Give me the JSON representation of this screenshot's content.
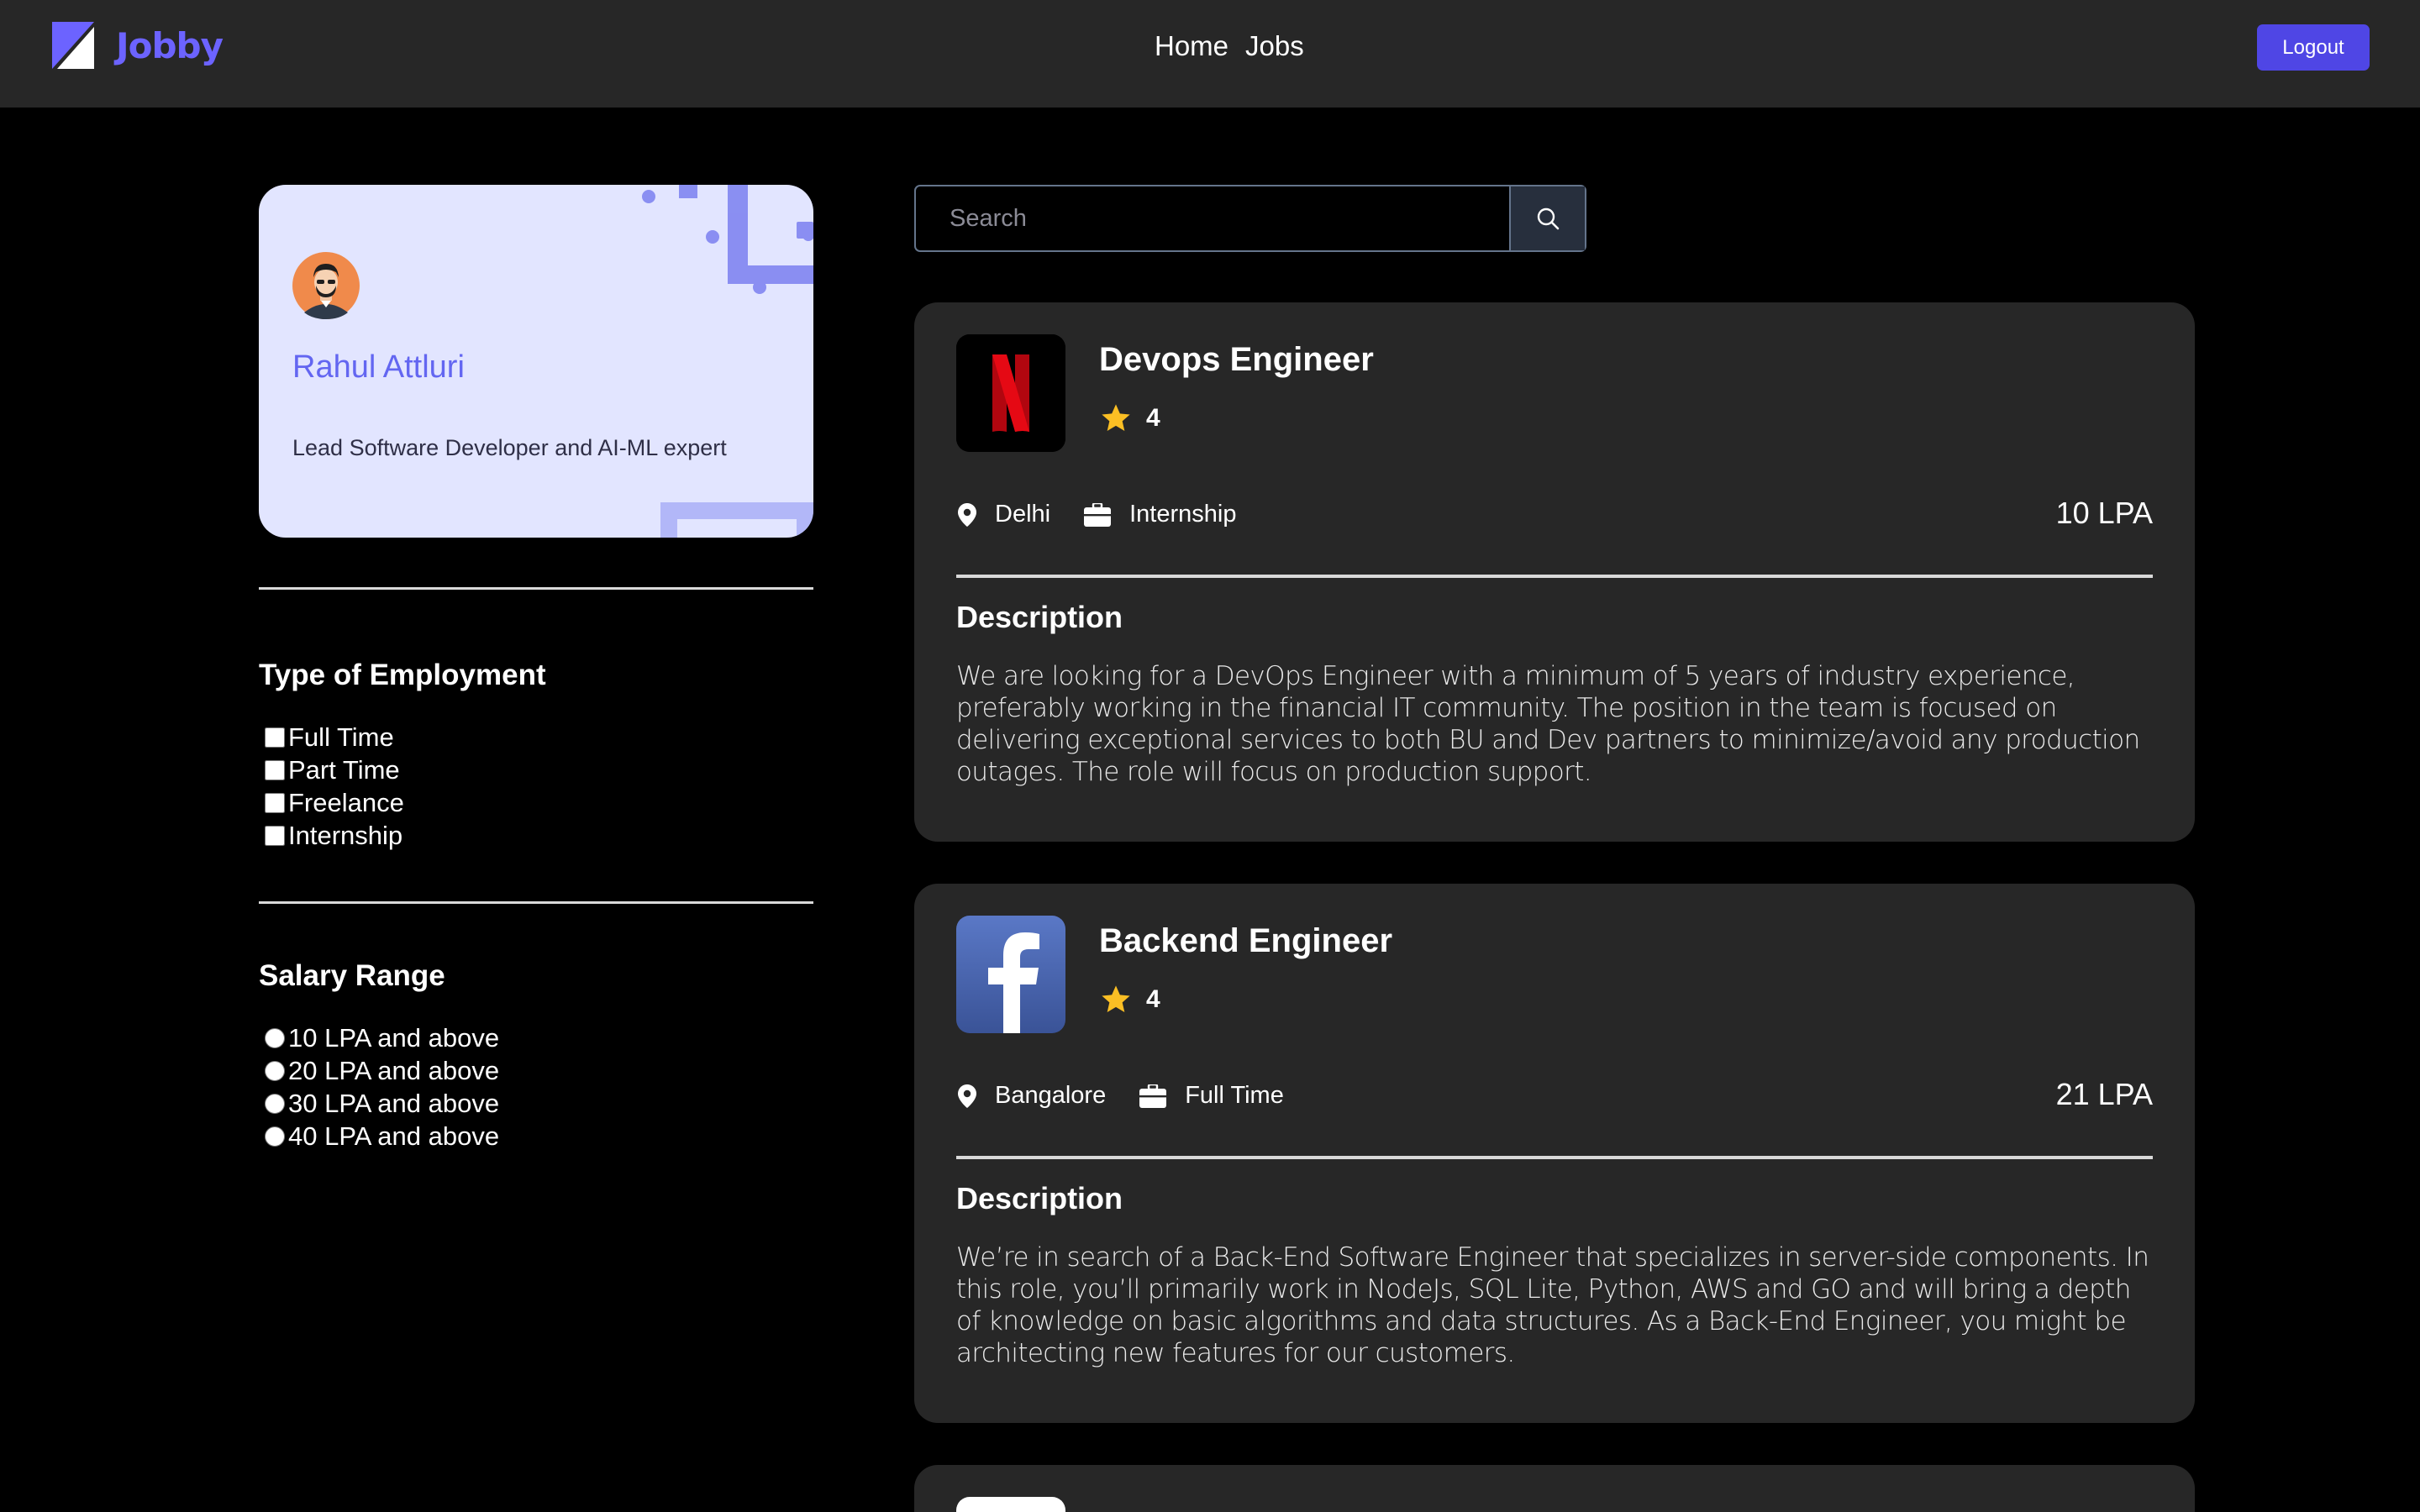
{
  "header": {
    "brand": "Jobby",
    "nav": [
      {
        "label": "Home"
      },
      {
        "label": "Jobs"
      }
    ],
    "logout_label": "Logout"
  },
  "profile": {
    "name": "Rahul Attluri",
    "bio": "Lead Software Developer and AI-ML expert"
  },
  "filters": {
    "employment": {
      "title": "Type of Employment",
      "options": [
        {
          "label": "Full Time",
          "checked": false
        },
        {
          "label": "Part Time",
          "checked": false
        },
        {
          "label": "Freelance",
          "checked": false
        },
        {
          "label": "Internship",
          "checked": false
        }
      ]
    },
    "salary": {
      "title": "Salary Range",
      "options": [
        {
          "label": "10 LPA and above",
          "checked": false
        },
        {
          "label": "20 LPA and above",
          "checked": false
        },
        {
          "label": "30 LPA and above",
          "checked": false
        },
        {
          "label": "40 LPA and above",
          "checked": false
        }
      ]
    }
  },
  "search": {
    "placeholder": "Search",
    "value": ""
  },
  "jobs": [
    {
      "company_icon": "netflix-logo",
      "title": "Devops Engineer",
      "rating": "4",
      "location": "Delhi",
      "employment_type": "Internship",
      "salary": "10 LPA",
      "description_heading": "Description",
      "description": "We are looking for a DevOps Engineer with a minimum of 5 years of industry experience, preferably working in the financial IT community. The position in the team is focused on delivering exceptional services to both BU and Dev partners to minimize/avoid any production outages. The role will focus on production support."
    },
    {
      "company_icon": "facebook-logo",
      "title": "Backend Engineer",
      "rating": "4",
      "location": "Bangalore",
      "employment_type": "Full Time",
      "salary": "21 LPA",
      "description_heading": "Description",
      "description": "We’re in search of a Back-End Software Engineer that specializes in server-side components. In this role, you’ll primarily work in NodeJs, SQL Lite, Python, AWS and GO and will bring a depth of knowledge on basic algorithms and data structures. As a Back-End Engineer, you might be architecting new features for our customers."
    }
  ],
  "colors": {
    "accent": "#4f46e5",
    "brand": "#6c63ff",
    "card_bg": "#272727",
    "profile_bg": "#e2e5ff",
    "star": "#fbbf24"
  }
}
